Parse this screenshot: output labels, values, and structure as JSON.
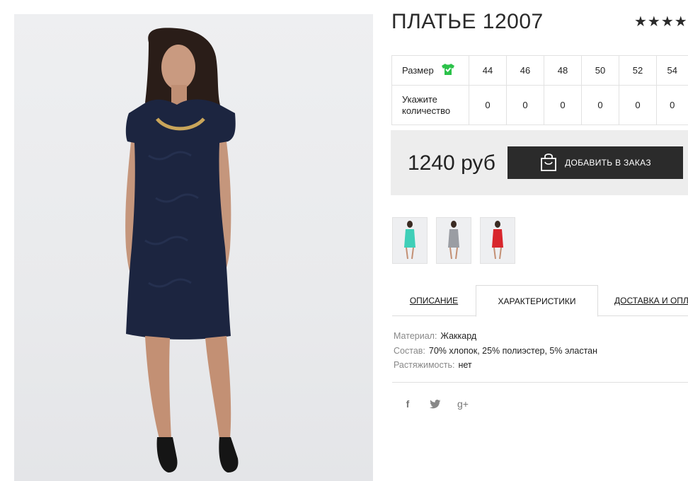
{
  "product": {
    "title": "ПЛАТЬЕ 12007",
    "rating_stars": "★★★★★"
  },
  "size_table": {
    "size_label": "Размер",
    "quantity_label": "Укажите количество",
    "sizes": [
      "44",
      "46",
      "48",
      "50",
      "52",
      "54"
    ],
    "quantities": [
      "0",
      "0",
      "0",
      "0",
      "0",
      "0"
    ]
  },
  "purchase": {
    "price": "1240 руб",
    "add_to_order_label": "ДОБАВИТЬ В ЗАКАЗ"
  },
  "thumbnails": [
    {
      "color_name": "turquoise",
      "color": "#3fcfb8"
    },
    {
      "color_name": "grey",
      "color": "#9a9da3"
    },
    {
      "color_name": "red",
      "color": "#d8262c"
    }
  ],
  "tabs": {
    "description": "ОПИСАНИЕ",
    "characteristics": "ХАРАКТЕРИСТИКИ",
    "delivery": "ДОСТАВКА И ОПЛАТА"
  },
  "specs": [
    {
      "key": "Материал:",
      "value": "Жаккард"
    },
    {
      "key": "Состав:",
      "value": "70% хлопок, 25% полиэстер, 5% эластан"
    },
    {
      "key": "Растяжимость:",
      "value": "нет"
    }
  ],
  "social": {
    "facebook": "f",
    "twitter": "twitter-icon",
    "google_plus": "g+"
  },
  "colors": {
    "main_dress": "#1c2540",
    "button_bg": "#2b2b2b",
    "price_box_bg": "#ededed",
    "size_icon_green": "#2bc24a"
  }
}
